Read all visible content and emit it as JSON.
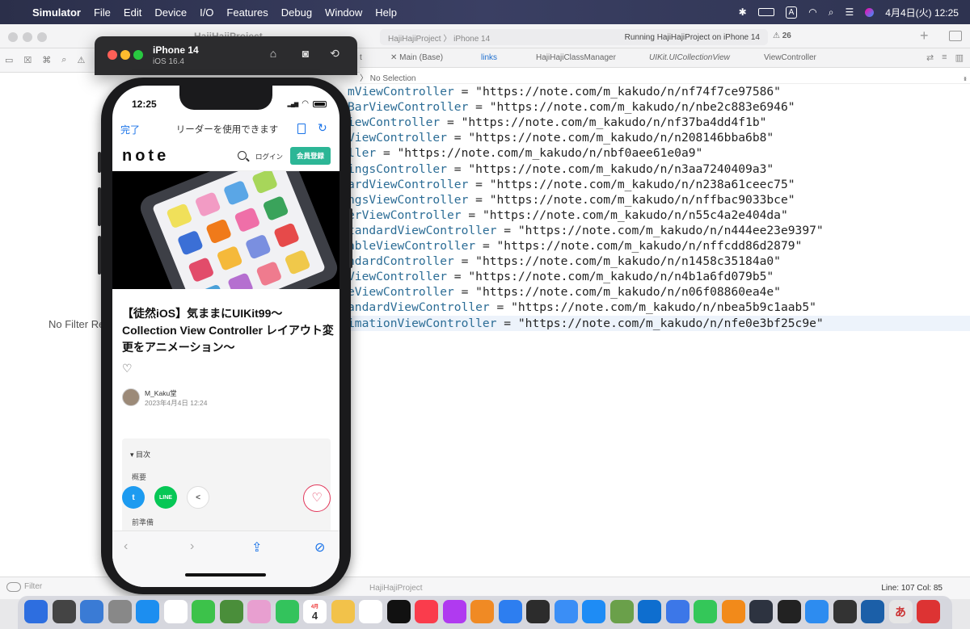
{
  "menubar": {
    "app": "Simulator",
    "items": [
      "File",
      "Edit",
      "Device",
      "I/O",
      "Features",
      "Debug",
      "Window",
      "Help"
    ],
    "ime": "A",
    "clock": "4月4日(火)  12:25"
  },
  "xcode": {
    "project": "HajiHajiProject",
    "scheme_target": "HajiHajiProject 〉 iPhone 14",
    "status": "Running HajiHajiProject on iPhone 14",
    "warnings": "26",
    "nav_placeholder": "No Filter Re",
    "filter_label": "Filter",
    "tabs": [
      {
        "label": "t"
      },
      {
        "label": "✕ Main (Base)"
      },
      {
        "label": "links"
      },
      {
        "label": "HajiHajiClassManager"
      },
      {
        "label": "UIKit.UICollectionView"
      },
      {
        "label": "ViewController"
      }
    ],
    "jumpbar": "〉 No Selection",
    "code_lines": [
      {
        "ident": "mViewController",
        "str": " = \"https://note.com/m_kakudo/n/nf74f7ce97586\""
      },
      {
        "ident": "BarViewController",
        "str": " = \"https://note.com/m_kakudo/n/nbe2c883e6946\""
      },
      {
        "ident": "iewController",
        "str": " = \"https://note.com/m_kakudo/n/nf37ba4dd4f1b\""
      },
      {
        "ident": "ViewController",
        "str": " = \"https://note.com/m_kakudo/n/n208146bba6b8\""
      },
      {
        "ident": "ller",
        "str": " = \"https://note.com/m_kakudo/n/nbf0aee61e0a9\""
      },
      {
        "ident": "ingsController",
        "str": " = \"https://note.com/m_kakudo/n/n3aa7240409a3\""
      },
      {
        "ident": "ardViewController",
        "str": " = \"https://note.com/m_kakudo/n/n238a61ceec75\""
      },
      {
        "ident": "ngsViewController",
        "str": " = \"https://note.com/m_kakudo/n/nffbac9033bce\""
      },
      {
        "ident": "erViewController",
        "str": " = \"https://note.com/m_kakudo/n/n55c4a2e404da\""
      },
      {
        "ident": "tandardViewController",
        "str": " = \"https://note.com/m_kakudo/n/n444ee23e9397\""
      },
      {
        "ident": "ableViewController",
        "str": " = \"https://note.com/m_kakudo/n/nffcdd86d2879\""
      },
      {
        "ident": "ndardController",
        "str": " = \"https://note.com/m_kakudo/n/n1458c35184a0\""
      },
      {
        "ident": "ViewController",
        "str": " = \"https://note.com/m_kakudo/n/n4b1a6fd079b5\""
      },
      {
        "ident": "eViewController",
        "str": " = \"https://note.com/m_kakudo/n/n06f08860ea4e\""
      },
      {
        "ident": "andardViewController",
        "str": " = \"https://note.com/m_kakudo/n/nbea5b9c1aab5\""
      },
      {
        "ident": "imationViewController",
        "str": " = \"https://note.com/m_kakudo/n/nfe0e3bf25c9e\""
      }
    ],
    "cursor": "Line: 107  Col: 85"
  },
  "simulator": {
    "device": "iPhone 14",
    "os": "iOS 16.4"
  },
  "phone": {
    "time": "12:25",
    "safari": {
      "done": "完了",
      "reader": "リーダーを使用できます"
    },
    "note": {
      "logo": "note",
      "login": "ログイン",
      "signup": "会員登録",
      "title": "【徒然iOS】気ままにUIKit99〜Collection View Controller レイアウト変更をアニメーション〜",
      "author": "M_Kaku堂",
      "date": "2023年4月4日 12:24",
      "toc_heading": "目次",
      "toc_items": [
        "概要",
        "前準備"
      ]
    }
  },
  "dock": {
    "calendar_month": "4月",
    "calendar_day": "4",
    "jp_input": "あ"
  }
}
